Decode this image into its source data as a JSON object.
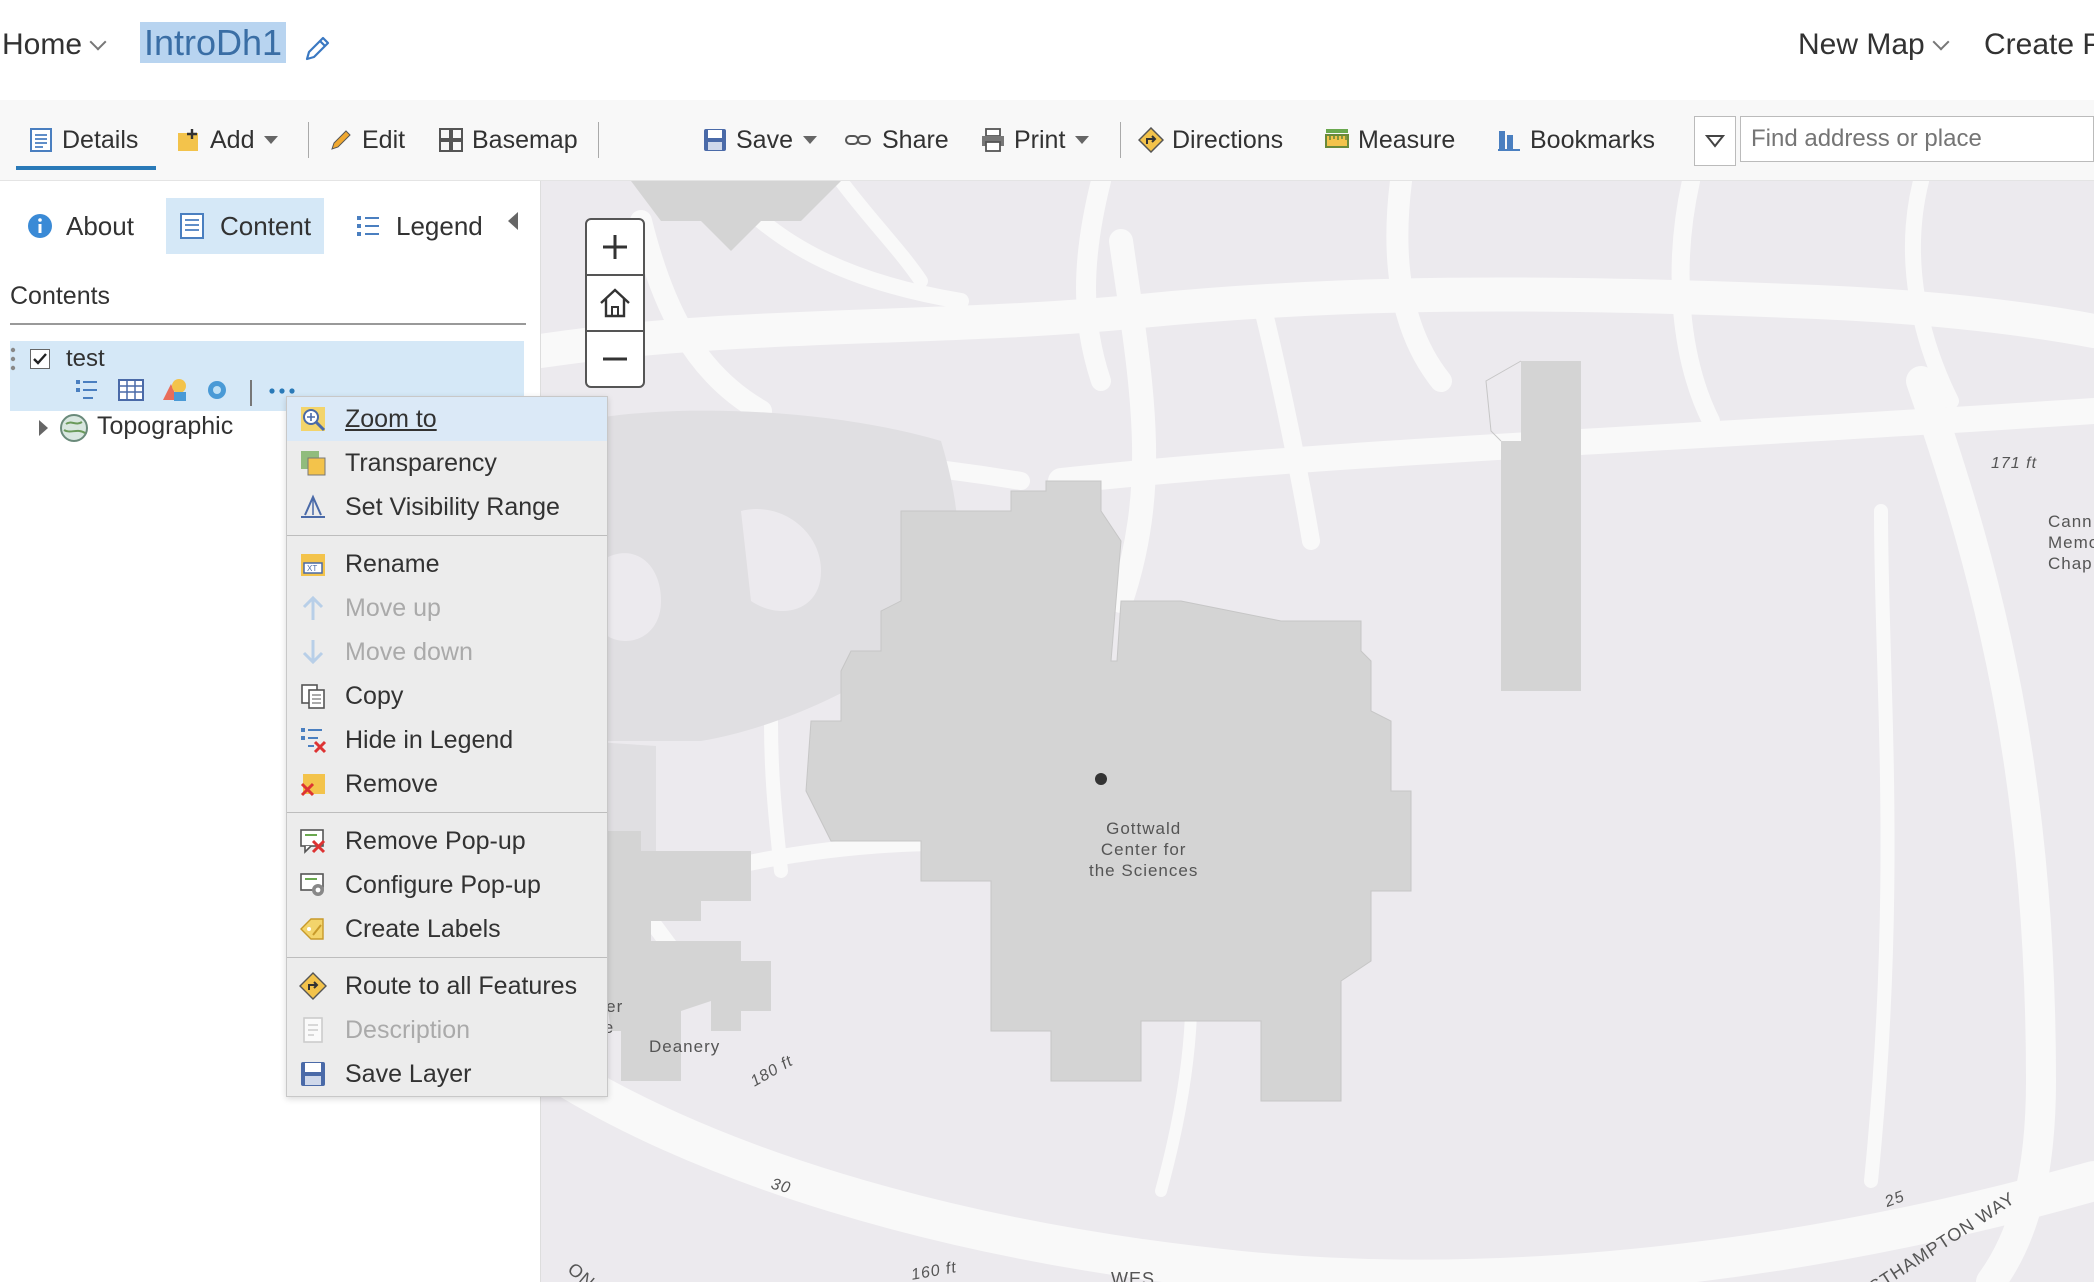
{
  "topbar": {
    "home_label": "Home",
    "map_title": "IntroDh1",
    "new_map_label": "New Map",
    "create_label": "Create P"
  },
  "toolbar": {
    "details": "Details",
    "add": "Add",
    "edit": "Edit",
    "basemap": "Basemap",
    "save": "Save",
    "share": "Share",
    "print": "Print",
    "directions": "Directions",
    "measure": "Measure",
    "bookmarks": "Bookmarks",
    "search_placeholder": "Find address or place"
  },
  "panel": {
    "tabs": {
      "about": "About",
      "content": "Content",
      "legend": "Legend"
    },
    "contents_heading": "Contents",
    "layers": [
      {
        "name": "test",
        "checked": true
      },
      {
        "name": "Topographic"
      }
    ]
  },
  "context_menu": {
    "groups": [
      [
        {
          "label": "Zoom to",
          "icon": "zoom-to-icon",
          "state": "hover"
        },
        {
          "label": "Transparency",
          "icon": "transparency-icon"
        },
        {
          "label": "Set Visibility Range",
          "icon": "visibility-range-icon"
        }
      ],
      [
        {
          "label": "Rename",
          "icon": "rename-icon"
        },
        {
          "label": "Move up",
          "icon": "move-up-icon",
          "state": "disabled"
        },
        {
          "label": "Move down",
          "icon": "move-down-icon",
          "state": "disabled"
        },
        {
          "label": "Copy",
          "icon": "copy-icon"
        },
        {
          "label": "Hide in Legend",
          "icon": "hide-legend-icon"
        },
        {
          "label": "Remove",
          "icon": "remove-icon"
        }
      ],
      [
        {
          "label": "Remove Pop-up",
          "icon": "remove-popup-icon"
        },
        {
          "label": "Configure Pop-up",
          "icon": "configure-popup-icon"
        },
        {
          "label": "Create Labels",
          "icon": "create-labels-icon"
        }
      ],
      [
        {
          "label": "Route to all Features",
          "icon": "route-icon"
        },
        {
          "label": "Description",
          "icon": "description-icon",
          "state": "disabled"
        },
        {
          "label": "Save Layer",
          "icon": "save-layer-icon"
        }
      ]
    ]
  },
  "map": {
    "labels": {
      "gottwald": "Gottwald\nCenter for\nthe Sciences",
      "deanery": "Deanery",
      "thalhimer": "Thalhimer\nCottage",
      "cannon": "Cann\nMemo\nChap",
      "elev_171": "171 ft",
      "elev_180": "180 ft",
      "elev_160": "160 ft",
      "road_30": "30",
      "road_25": "25",
      "westhampton": "WESTHAMPTON WAY",
      "on_way": "ON WAY",
      "wes": "WES"
    },
    "colors": {
      "background": "#eceaee",
      "building": "#d4d4d4",
      "road": "#f9f9f9"
    }
  }
}
